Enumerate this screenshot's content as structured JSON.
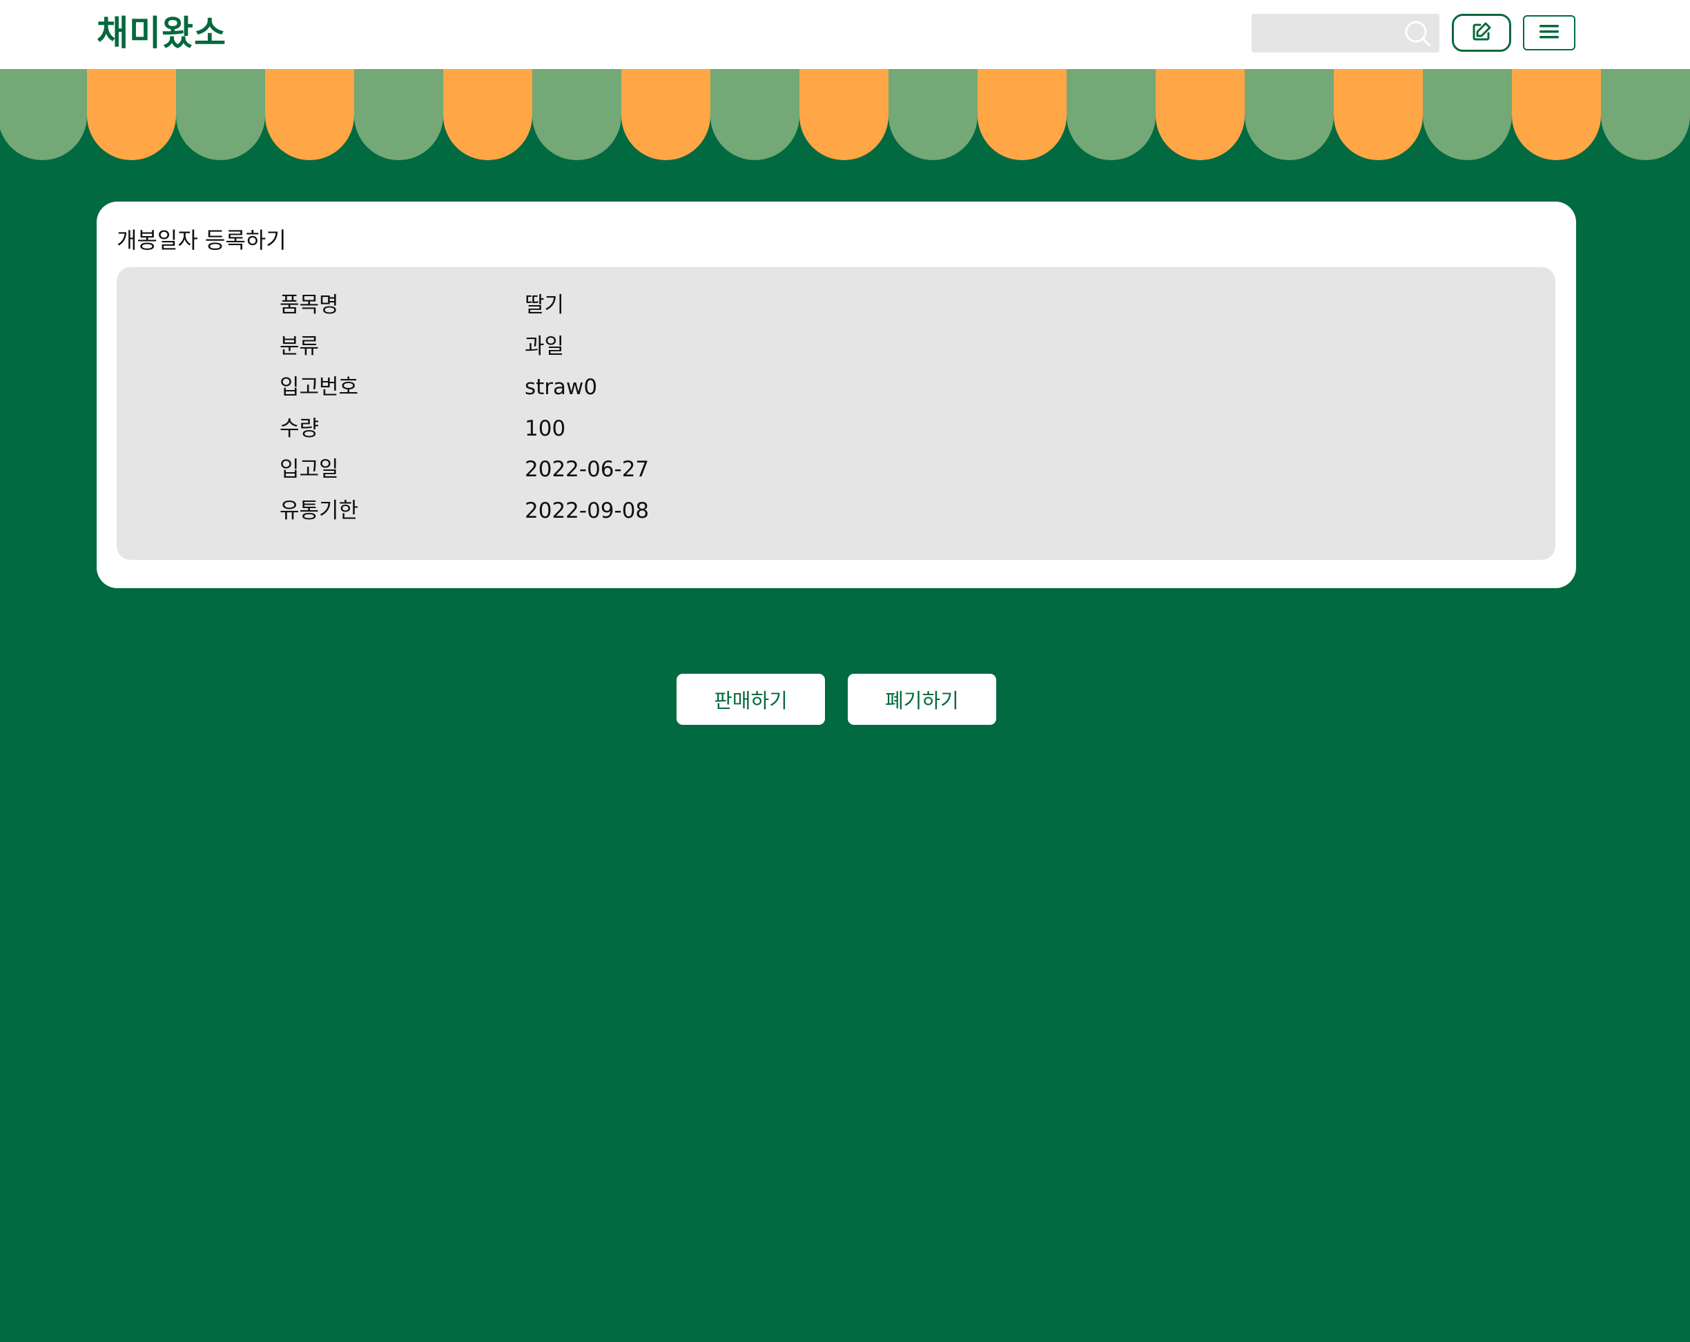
{
  "header": {
    "logo": "채미왔소",
    "search": {
      "value": "",
      "placeholder": ""
    },
    "search_icon": "search-icon",
    "write_icon": "edit-icon",
    "menu_icon": "hamburger-menu-icon"
  },
  "colors": {
    "brand_green": "#04693d",
    "background_green": "#026a40",
    "awning_green": "#74a876",
    "awning_orange": "#ffa646",
    "panel_gray": "#e5e5e5"
  },
  "card": {
    "title": "개봉일자 등록하기",
    "rows": [
      {
        "label": "품목명",
        "value": "딸기"
      },
      {
        "label": "분류",
        "value": "과일"
      },
      {
        "label": "입고번호",
        "value": "straw0"
      },
      {
        "label": "수량",
        "value": "100"
      },
      {
        "label": "입고일",
        "value": "2022-06-27"
      },
      {
        "label": "유통기한",
        "value": "2022-09-08"
      }
    ]
  },
  "actions": {
    "sell_label": "판매하기",
    "discard_label": "폐기하기"
  }
}
